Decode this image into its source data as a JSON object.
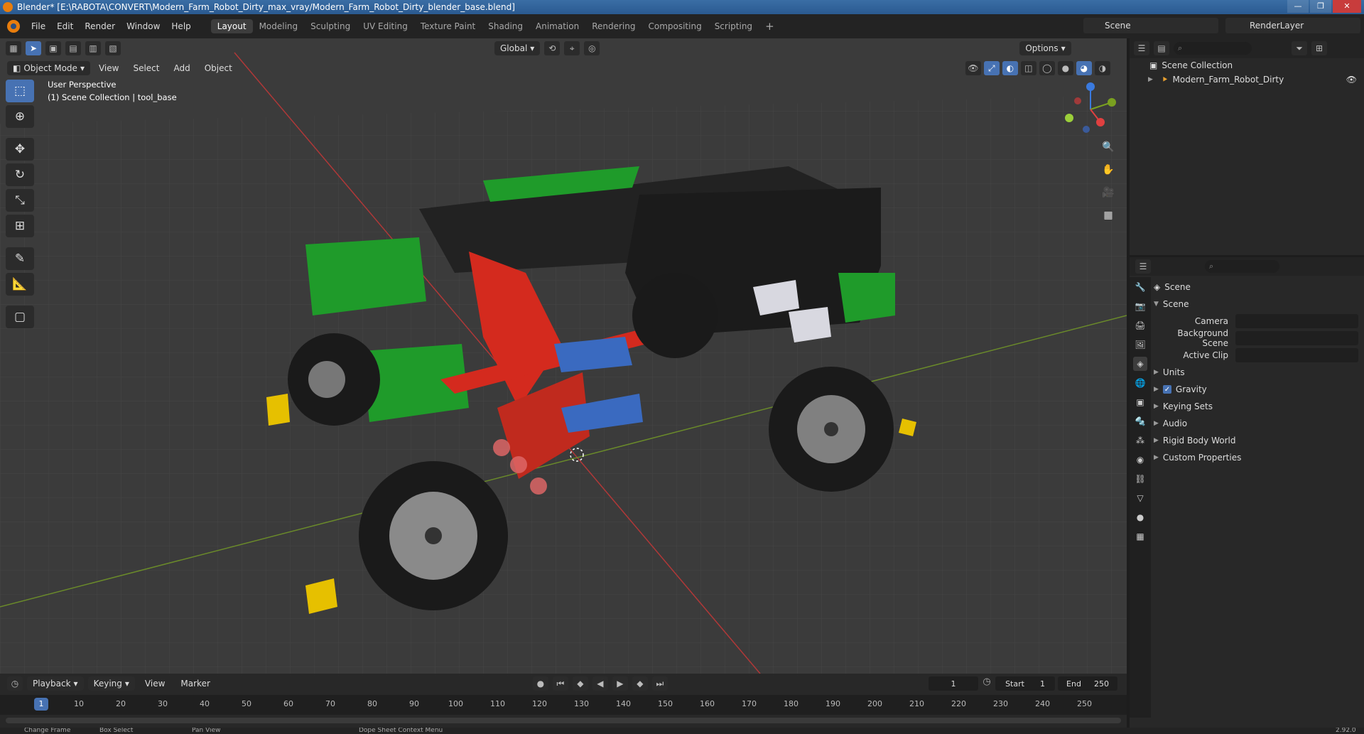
{
  "window": {
    "title": "Blender* [E:\\RABOTA\\CONVERT\\Modern_Farm_Robot_Dirty_max_vray/Modern_Farm_Robot_Dirty_blender_base.blend]"
  },
  "menu": [
    "File",
    "Edit",
    "Render",
    "Window",
    "Help"
  ],
  "workspaces": [
    "Layout",
    "Modeling",
    "Sculpting",
    "UV Editing",
    "Texture Paint",
    "Shading",
    "Animation",
    "Rendering",
    "Compositing",
    "Scripting"
  ],
  "scene_selector": "Scene",
  "view_layer": "RenderLayer",
  "viewport": {
    "mode": "Object Mode",
    "menus": [
      "View",
      "Select",
      "Add",
      "Object"
    ],
    "transform_orientation": "Global",
    "options_label": "Options",
    "info_line1": "User Perspective",
    "info_line2": "(1) Scene Collection | tool_base"
  },
  "outliner": {
    "root": "Scene Collection",
    "items": [
      "Modern_Farm_Robot_Dirty"
    ]
  },
  "properties": {
    "context": "Scene",
    "panel": "Scene",
    "fields": [
      {
        "label": "Camera",
        "value": ""
      },
      {
        "label": "Background Scene",
        "value": ""
      },
      {
        "label": "Active Clip",
        "value": ""
      }
    ],
    "sections": [
      "Units",
      "Gravity",
      "Keying Sets",
      "Audio",
      "Rigid Body World",
      "Custom Properties"
    ]
  },
  "timeline": {
    "menus": [
      "Playback",
      "Keying",
      "View",
      "Marker"
    ],
    "current_frame": "1",
    "start_label": "Start",
    "start": "1",
    "end_label": "End",
    "end": "250",
    "ticks": [
      "10",
      "20",
      "30",
      "40",
      "50",
      "60",
      "70",
      "80",
      "90",
      "100",
      "110",
      "120",
      "130",
      "140",
      "150",
      "160",
      "170",
      "180",
      "190",
      "200",
      "210",
      "220",
      "230",
      "240",
      "250"
    ]
  },
  "status": {
    "items": [
      "Change Frame",
      "Box Select",
      "Pan View",
      "Dope Sheet Context Menu"
    ],
    "version": "2.92.0"
  },
  "colors": {
    "accent": "#4772b3",
    "robot_green": "#1f9b2a",
    "robot_red": "#d42a1e",
    "robot_black": "#1e1e1e"
  }
}
